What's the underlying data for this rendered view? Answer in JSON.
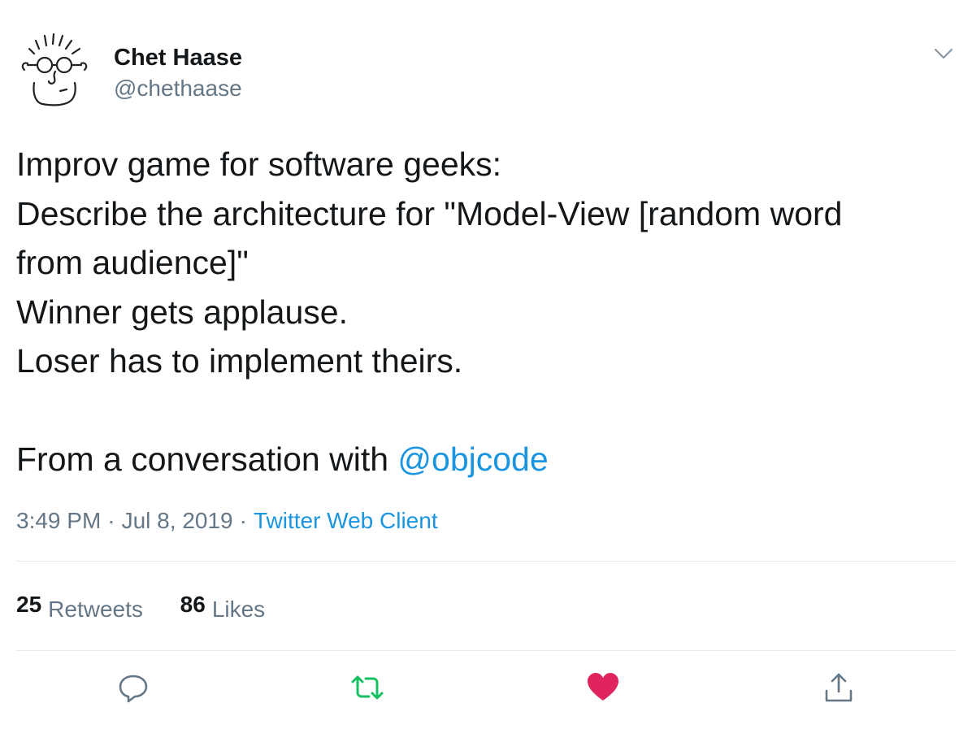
{
  "author": {
    "display_name": "Chet Haase",
    "handle": "@chethaase"
  },
  "tweet": {
    "lines": [
      "Improv game for software geeks:",
      "Describe the architecture for \"Model-View [random word",
      "from audience]\"",
      "Winner gets applause.",
      "Loser has to implement theirs."
    ],
    "last_line_prefix": "From a conversation with ",
    "mention": "@objcode"
  },
  "meta": {
    "time": "3:49 PM",
    "separator": "·",
    "date": "Jul 8, 2019",
    "source": "Twitter Web Client"
  },
  "stats": {
    "retweets_count": "25",
    "retweets_label": "Retweets",
    "likes_count": "86",
    "likes_label": "Likes"
  },
  "icons": {
    "reply": "reply-icon",
    "retweet": "retweet-icon",
    "like": "heart-icon",
    "share": "share-icon",
    "more": "chevron-down-icon"
  },
  "colors": {
    "text": "#14171a",
    "secondary": "#657786",
    "link": "#1b95e0",
    "retweet_active": "#17bf63",
    "like_active": "#e0245e",
    "divider": "#e6ecf0"
  }
}
